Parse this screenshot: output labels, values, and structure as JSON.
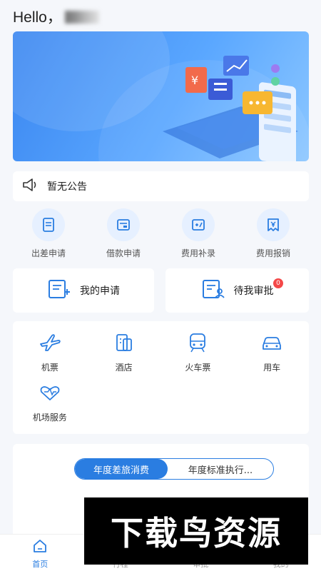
{
  "header": {
    "greeting": "Hello，"
  },
  "notice": {
    "text": "暂无公告",
    "icon": "speaker-icon"
  },
  "quick_actions": [
    {
      "label": "出差申请",
      "icon": "document-icon"
    },
    {
      "label": "借款申请",
      "icon": "card-icon"
    },
    {
      "label": "费用补录",
      "icon": "edit-icon"
    },
    {
      "label": "费用报销",
      "icon": "receipt-icon"
    }
  ],
  "cards": {
    "my_requests": "我的申请",
    "pending_approval": "待我审批",
    "pending_badge": "0"
  },
  "services": [
    {
      "label": "机票",
      "icon": "plane-icon"
    },
    {
      "label": "酒店",
      "icon": "hotel-icon"
    },
    {
      "label": "火车票",
      "icon": "train-icon"
    },
    {
      "label": "用车",
      "icon": "car-icon"
    },
    {
      "label": "机场服务",
      "icon": "airport-service-icon"
    }
  ],
  "stats": {
    "tab_active": "年度差旅消费",
    "tab_inactive": "年度标准执行..."
  },
  "tabbar": [
    {
      "label": "首页",
      "icon": "home-icon",
      "active": true
    },
    {
      "label": "行程",
      "icon": "itinerary-icon",
      "active": false
    },
    {
      "label": "审批",
      "icon": "approval-icon",
      "active": false
    },
    {
      "label": "我的",
      "icon": "profile-icon",
      "active": false
    }
  ],
  "watermark": {
    "text": "下载鸟资源"
  },
  "colors": {
    "accent": "#2a7de1",
    "badge": "#f44848",
    "icon_bg": "#e6f0ff"
  }
}
